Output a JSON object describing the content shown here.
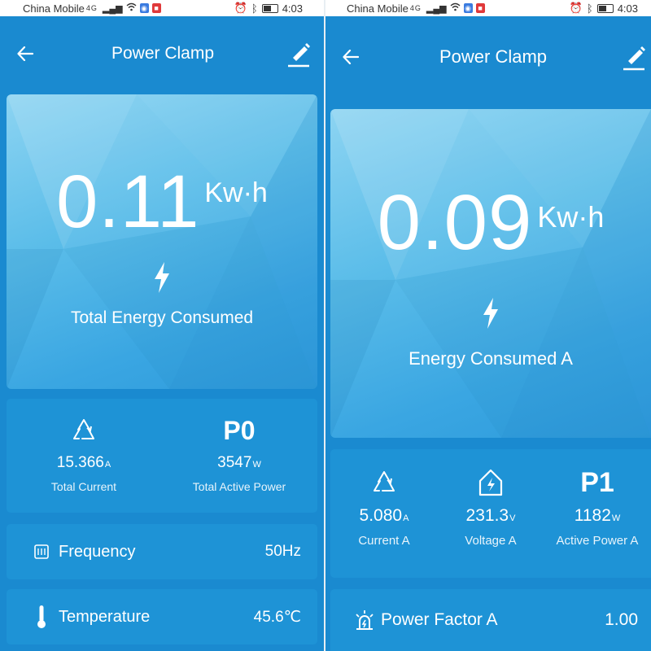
{
  "left": {
    "status_bar": {
      "carrier": "China Mobile",
      "network": "4G",
      "time": "4:03"
    },
    "app_bar": {
      "title": "Power Clamp"
    },
    "hero": {
      "value": "0.11",
      "unit": "Kw·h",
      "caption": "Total Energy Consumed"
    },
    "metrics": [
      {
        "icon": "recycle-icon",
        "value": "15.366",
        "unit": "A",
        "label": "Total Current"
      },
      {
        "icon": "p-code",
        "code": "P0",
        "value": "3547",
        "unit": "W",
        "label": "Total Active Power"
      }
    ],
    "rows": [
      {
        "icon": "frequency-icon",
        "label": "Frequency",
        "value": "50Hz"
      },
      {
        "icon": "thermometer-icon",
        "label": "Temperature",
        "value": "45.6℃"
      }
    ]
  },
  "right": {
    "status_bar": {
      "carrier": "China Mobile",
      "network": "4G",
      "time": "4:03"
    },
    "app_bar": {
      "title": "Power Clamp"
    },
    "hero": {
      "value": "0.09",
      "unit": "Kw·h",
      "caption": "Energy Consumed A"
    },
    "metrics": [
      {
        "icon": "recycle-icon",
        "value": "5.080",
        "unit": "A",
        "label": "Current A"
      },
      {
        "icon": "house-bolt-icon",
        "value": "231.3",
        "unit": "V",
        "label": "Voltage A"
      },
      {
        "icon": "p-code",
        "code": "P1",
        "value": "1182",
        "unit": "W",
        "label": "Active Power A"
      }
    ],
    "rows": [
      {
        "icon": "alarm-light-icon",
        "label": "Power Factor A",
        "value": "1.00"
      }
    ]
  },
  "colors": {
    "app_bg": "#1a8ad0",
    "card_bg": "#1e93d6",
    "hero_light": "#8dd4f2",
    "hero_dark": "#2e9bdc",
    "status_bar_bg": "#ffffff"
  }
}
